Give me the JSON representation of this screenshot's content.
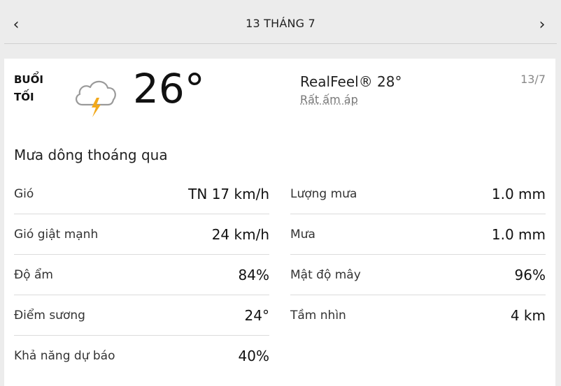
{
  "header": {
    "prev_icon": "‹",
    "title": "13 THÁNG 7",
    "next_icon": "›"
  },
  "card": {
    "period_line1": "BUỔI",
    "period_line2": "TỐI",
    "icon": "cloud-thunderstorm-icon",
    "temperature": "26°",
    "realfeel": "RealFeel® 28°",
    "realfeel_desc": "Rất ấm áp",
    "date_short": "13/7",
    "phrase": "Mưa dông thoáng qua"
  },
  "details_left": [
    {
      "label": "Gió",
      "value": "TN 17 km/h"
    },
    {
      "label": "Gió giật mạnh",
      "value": "24 km/h"
    },
    {
      "label": "Độ ẩm",
      "value": "84%"
    },
    {
      "label": "Điểm sương",
      "value": "24°"
    },
    {
      "label": "Khả năng dự báo",
      "value": "40%"
    }
  ],
  "details_right": [
    {
      "label": "Lượng mưa",
      "value": "1.0 mm"
    },
    {
      "label": "Mưa",
      "value": "1.0 mm"
    },
    {
      "label": "Mật độ mây",
      "value": "96%"
    },
    {
      "label": "Tầm nhìn",
      "value": "4 km"
    }
  ],
  "colors": {
    "background": "#ececec",
    "card": "#ffffff",
    "lightning": "#f2a91c",
    "cloud_stroke": "#9a9a9a"
  }
}
